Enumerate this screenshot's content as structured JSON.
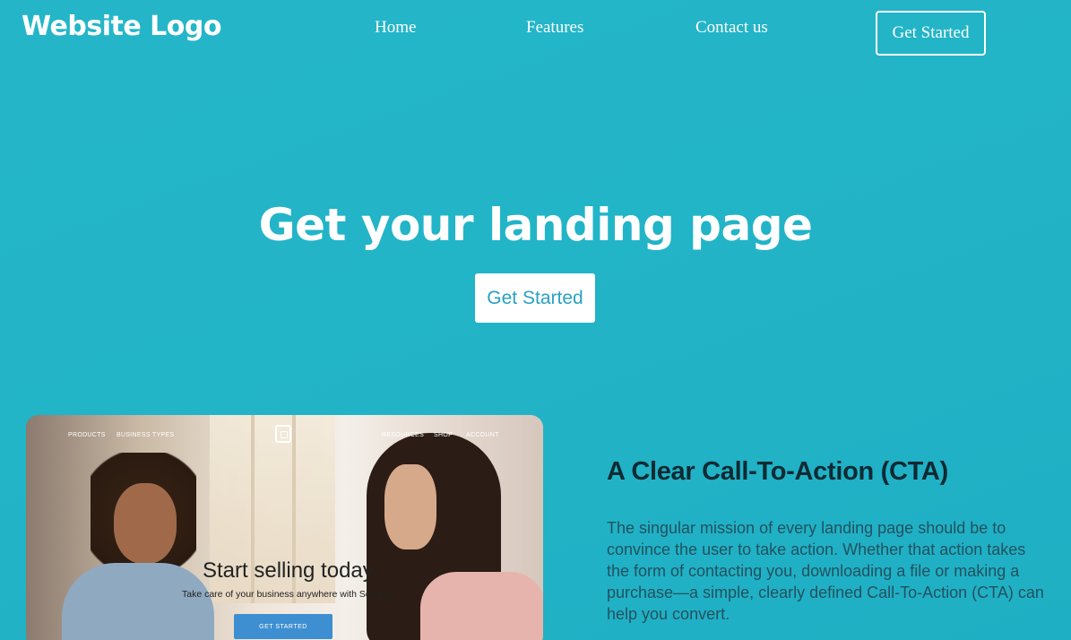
{
  "header": {
    "logo": "Website Logo",
    "nav": [
      {
        "label": "Home"
      },
      {
        "label": "Features"
      },
      {
        "label": "Contact us"
      }
    ],
    "cta_label": "Get Started"
  },
  "hero": {
    "title": "Get your landing page",
    "button_label": "Get Started"
  },
  "screenshot": {
    "nav_left": [
      "PRODUCTS",
      "BUSINESS TYPES"
    ],
    "nav_right": [
      "RESOURCES",
      "SHOP",
      "ACCOUNT"
    ],
    "headline": "Start selling today.",
    "subhead": "Take care of your business anywhere with Square.",
    "button_label": "GET STARTED"
  },
  "feature": {
    "title": "A Clear Call-To-Action (CTA)",
    "body": "The singular mission of every landing page should be to convince the user to take action. Whether that action takes the form of contacting you, downloading a file or making a purchase—a simple, clearly defined Call-To-Action (CTA) can help you convert."
  },
  "colors": {
    "background": "#22b3c7",
    "hero_button_text": "#2aa0c4",
    "feature_title": "#0e2a33",
    "feature_body": "#23525f",
    "embedded_cta": "#3d8fd1"
  }
}
